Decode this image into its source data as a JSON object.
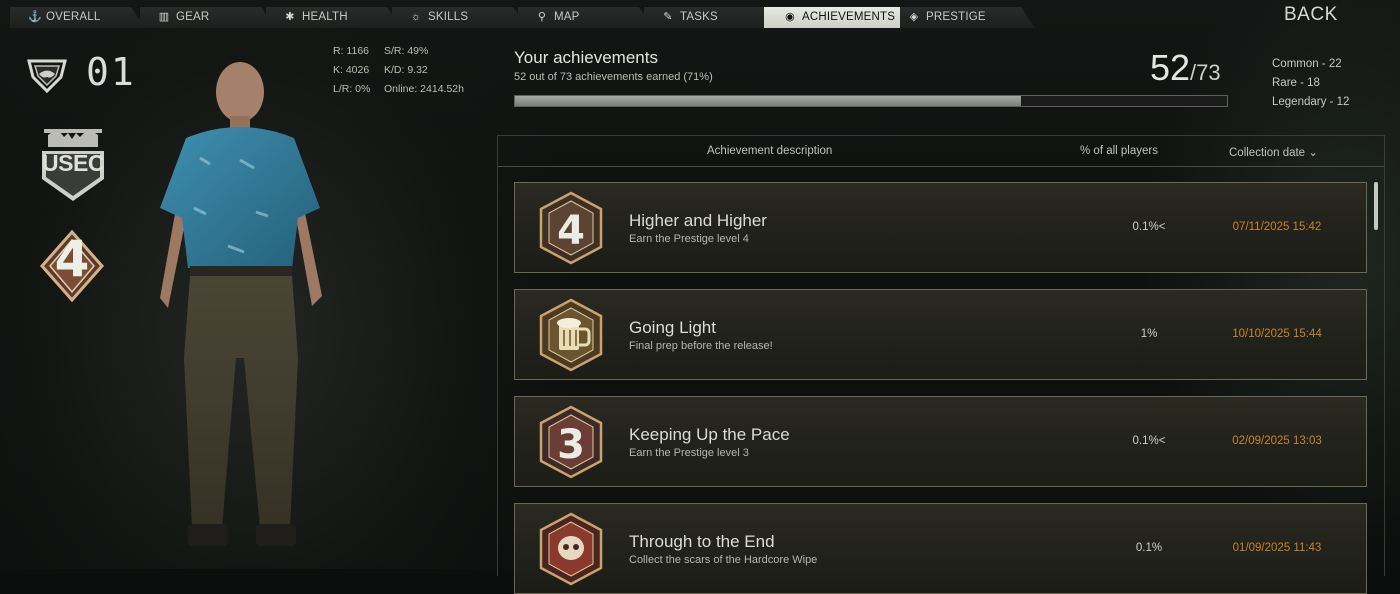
{
  "nav": {
    "tabs": [
      {
        "label": "OVERALL",
        "icon": "anchor-icon",
        "active": false
      },
      {
        "label": "GEAR",
        "icon": "vest-icon",
        "active": false
      },
      {
        "label": "HEALTH",
        "icon": "gear-cross-icon",
        "active": false
      },
      {
        "label": "SKILLS",
        "icon": "lightbulb-icon",
        "active": false
      },
      {
        "label": "MAP",
        "icon": "map-pin-icon",
        "active": false
      },
      {
        "label": "TASKS",
        "icon": "clipboard-edit-icon",
        "active": false
      },
      {
        "label": "ACHIEVEMENTS",
        "icon": "achievement-icon",
        "active": true
      },
      {
        "label": "PRESTIGE",
        "icon": "prestige-icon",
        "active": false
      }
    ],
    "back_label": "BACK"
  },
  "profile": {
    "level": "01",
    "faction": "USEC",
    "prestige_level": "4"
  },
  "stats": {
    "r": "R: 1166",
    "sr": "S/R: 49%",
    "k": "K: 4026",
    "kd": "K/D: 9.32",
    "lr": "L/R: 0%",
    "online": "Online: 2414.52h"
  },
  "summary": {
    "title": "Your achievements",
    "subtitle": "52 out of 73 achievements earned (71%)",
    "earned": "52",
    "total": "/73",
    "progress_fraction": 0.71,
    "common": "Common - 22",
    "rare": "Rare - 18",
    "legendary": "Legendary - 12"
  },
  "table": {
    "col_description": "Achievement description",
    "col_percent": "% of all players",
    "col_date": "Collection date ⌄"
  },
  "achievements": [
    {
      "name": "Higher and Higher",
      "description": "Earn the Prestige level 4",
      "percent": "0.1%<",
      "date": "07/11/2025 15:42",
      "icon": "prestige-4-badge-icon"
    },
    {
      "name": "Going Light",
      "description": "Final prep before the release!",
      "percent": "1%",
      "date": "10/10/2025 15:44",
      "icon": "beer-mug-badge-icon"
    },
    {
      "name": "Keeping Up the Pace",
      "description": "Earn the Prestige level 3",
      "percent": "0.1%<",
      "date": "02/09/2025 13:03",
      "icon": "prestige-3-badge-icon"
    },
    {
      "name": "Through to the End",
      "description": "Collect the scars of the Hardcore Wipe",
      "percent": "0.1%",
      "date": "01/09/2025 11:43",
      "icon": "hardcore-skull-badge-icon"
    }
  ],
  "colors": {
    "date_accent": "#c6842d",
    "active_tab": "#e2e2dd",
    "row_border": "#6a6752"
  }
}
